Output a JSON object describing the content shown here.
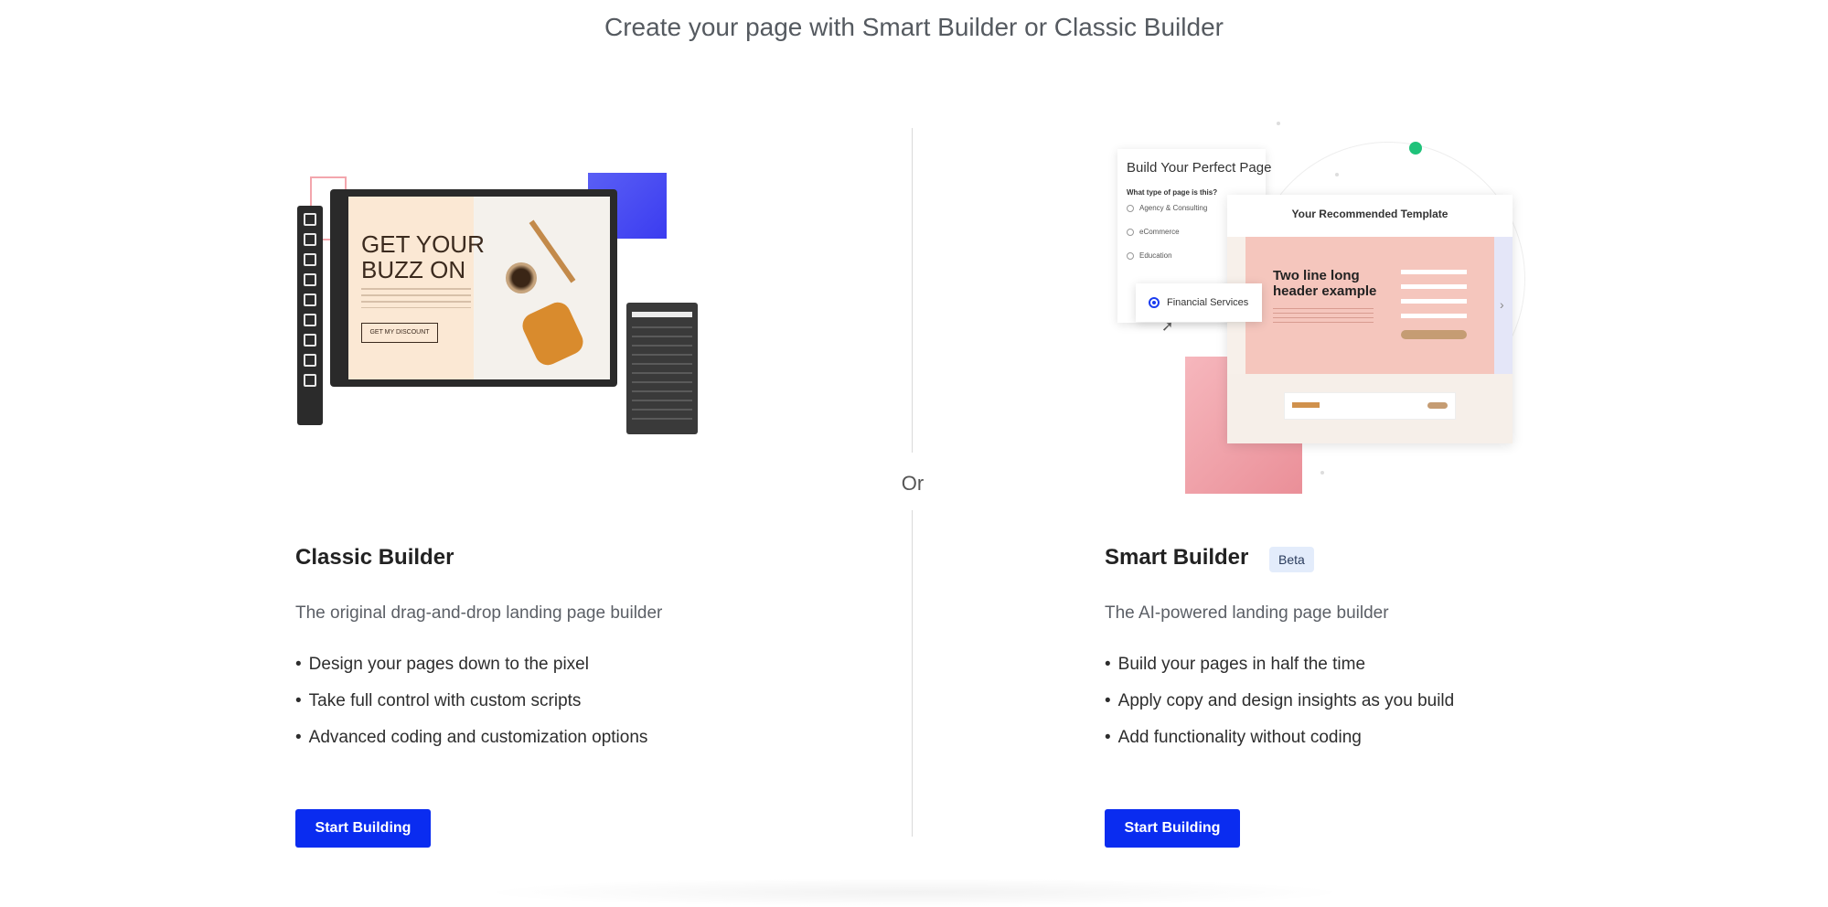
{
  "page": {
    "title": "Create your page with Smart Builder or Classic Builder",
    "or_label": "Or"
  },
  "classic": {
    "heading": "Classic Builder",
    "subtitle": "The original drag-and-drop landing page builder",
    "features": [
      "Design your pages down to the pixel",
      "Take full control with custom scripts",
      "Advanced coding and customization options"
    ],
    "button_label": "Start Building",
    "illustration": {
      "headline": "GET YOUR BUZZ ON",
      "cta": "GET MY DISCOUNT"
    }
  },
  "smart": {
    "heading": "Smart Builder",
    "badge": "Beta",
    "subtitle": "The AI-powered landing page builder",
    "features": [
      "Build your pages in half the time",
      "Apply copy and design insights as you build",
      "Add functionality without coding"
    ],
    "button_label": "Start Building",
    "illustration": {
      "wizard_title": "Build Your Perfect Page",
      "wizard_question": "What type of page is this?",
      "options": [
        "Agency & Consulting",
        "eCommerce",
        "Education"
      ],
      "selected_option": "Financial Services",
      "template_title": "Your Recommended Template",
      "hero_title": "Two line long header example"
    }
  },
  "colors": {
    "button_bg": "#0a2cf0",
    "badge_bg": "#e3ecfb",
    "divider": "#d9d9d9"
  }
}
